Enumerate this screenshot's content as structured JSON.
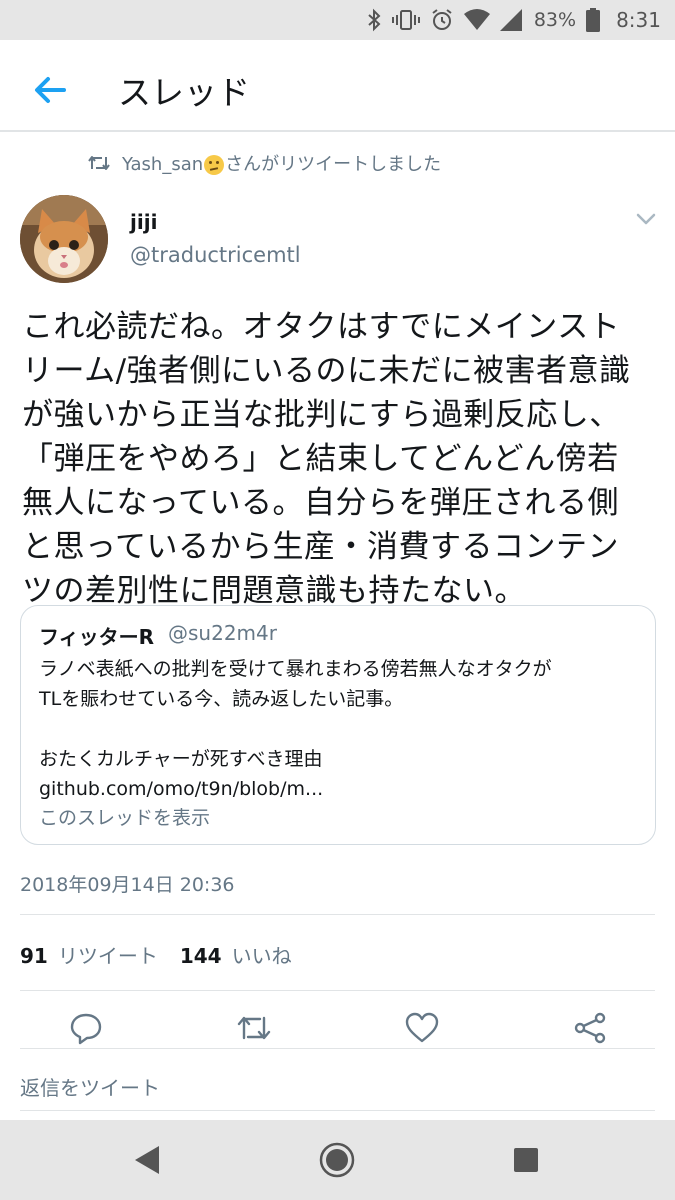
{
  "status_bar": {
    "battery_percent": "83%",
    "time": "8:31",
    "icons": [
      "bluetooth-icon",
      "vibrate-icon",
      "alarm-icon",
      "wifi-icon",
      "cell-signal-icon",
      "battery-icon"
    ]
  },
  "app_bar": {
    "title": "スレッド",
    "back_icon": "arrow-left-icon",
    "accent_color": "#1da1f2"
  },
  "retweet_context": {
    "user": "Yash_san",
    "suffix": "さんがリツイートしました",
    "icon": "retweet-icon"
  },
  "tweet": {
    "author_name": "jiji",
    "author_handle": "@traductricemtl",
    "text_lines": [
      "これ必読だね。オタクはすでにメインスト",
      "リーム/強者側にいるのに未だに被害者意識",
      "が強いから正当な批判にすら過剰反応し、",
      "「弾圧をやめろ」と結束してどんどん傍若",
      "無人になっている。自分らを弾圧される側",
      "と思っているから生産・消費するコンテン",
      "ツの差別性に問題意識も持たない。"
    ],
    "timestamp": "2018年09月14日 20:36"
  },
  "quote": {
    "name": "フィッターR",
    "handle": "@su22m4r",
    "lines": [
      "ラノベ表紙への批判を受けて暴れまわる傍若無人なオタクが",
      "TLを賑わせている今、読み返したい記事。",
      "",
      "おたくカルチャーが死すべき理由",
      "github.com/omo/t9n/blob/m..."
    ],
    "show_thread": "このスレッドを表示"
  },
  "counts": {
    "retweets": "91",
    "retweets_label": "リツイート",
    "likes": "144",
    "likes_label": "いいね"
  },
  "actions": [
    "reply-icon",
    "retweet-icon",
    "like-icon",
    "share-icon"
  ],
  "reply_placeholder": "返信をツイート",
  "nav_bar": [
    "back-triangle-icon",
    "home-circle-icon",
    "recents-square-icon"
  ]
}
